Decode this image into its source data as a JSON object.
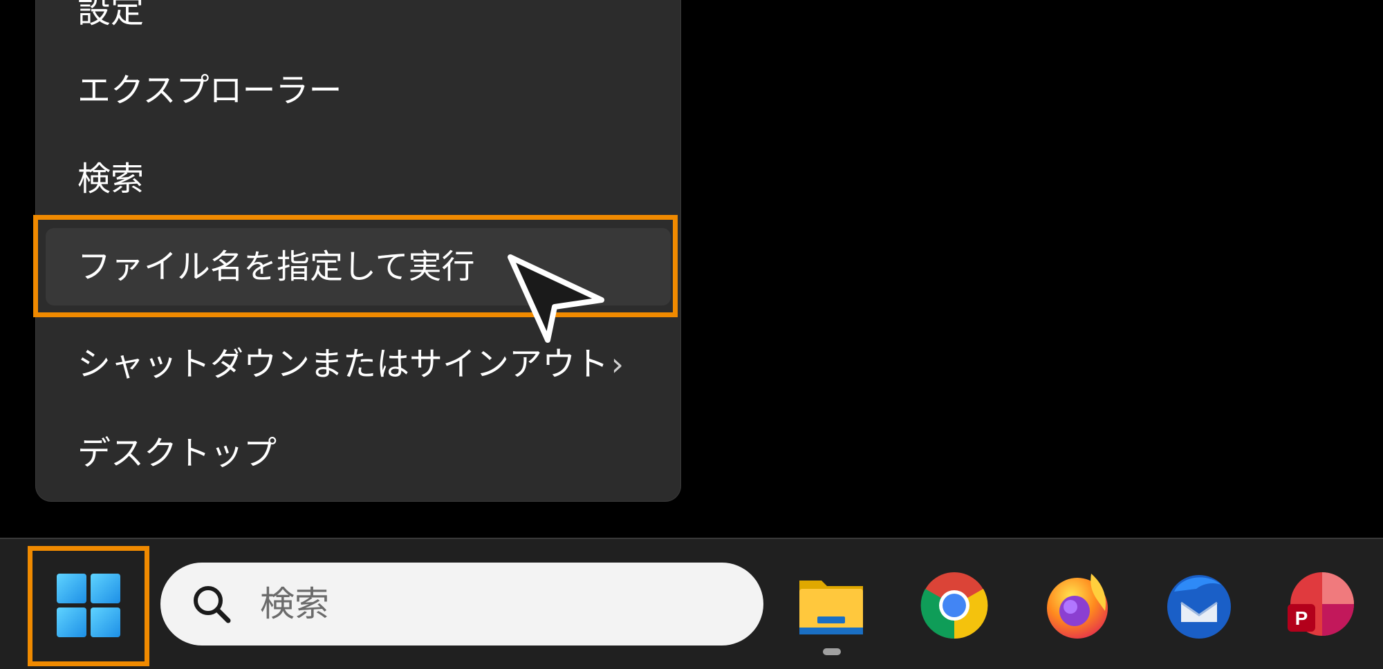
{
  "menu": {
    "items": [
      {
        "label": "設定"
      },
      {
        "label": "エクスプローラー"
      },
      {
        "label": "検索"
      },
      {
        "label": "ファイル名を指定して実行"
      },
      {
        "label": "シャットダウンまたはサインアウト",
        "submenu_glyph": "›"
      },
      {
        "label": "デスクトップ"
      }
    ]
  },
  "taskbar": {
    "search_placeholder": "検索",
    "apps": [
      {
        "name": "file-explorer-icon"
      },
      {
        "name": "chrome-icon"
      },
      {
        "name": "firefox-icon"
      },
      {
        "name": "thunderbird-icon"
      },
      {
        "name": "pdf-app-icon",
        "badge": "P"
      }
    ]
  },
  "colors": {
    "highlight": "#f08a00",
    "menu_bg": "#2c2c2c",
    "taskbar_bg": "#202020",
    "start_blue": "#36b4f0"
  }
}
